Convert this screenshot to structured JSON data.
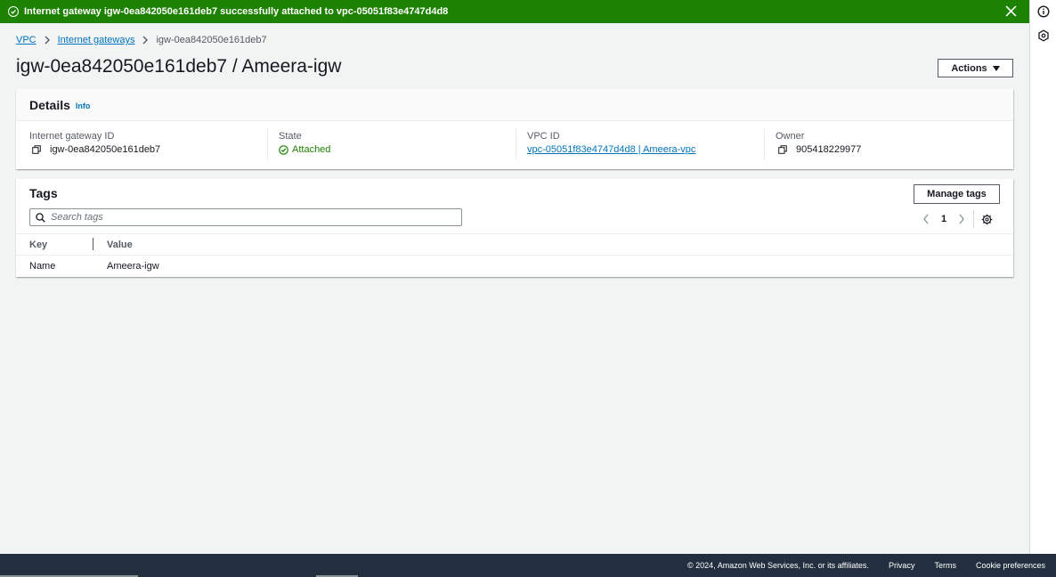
{
  "flash": {
    "message": "Internet gateway igw-0ea842050e161deb7 successfully attached to vpc-05051f83e4747d4d8",
    "color": "#1d8102"
  },
  "breadcrumb": {
    "items": [
      "VPC",
      "Internet gateways"
    ],
    "current": "igw-0ea842050e161deb7"
  },
  "page": {
    "title": "igw-0ea842050e161deb7 / Ameera-igw",
    "actions_label": "Actions"
  },
  "details": {
    "heading": "Details",
    "info": "Info",
    "fields": [
      {
        "label": "Internet gateway ID",
        "value": "igw-0ea842050e161deb7",
        "icon": "copy-icon"
      },
      {
        "label": "State",
        "value": "Attached",
        "icon": "status-check-icon"
      },
      {
        "label": "VPC ID",
        "value": "vpc-05051f83e4747d4d8 | Ameera-vpc",
        "icon": "link"
      },
      {
        "label": "Owner",
        "value": "905418229977",
        "icon": "copy-icon"
      }
    ]
  },
  "tags": {
    "heading": "Tags",
    "manage_label": "Manage tags",
    "search_placeholder": "Search tags",
    "page": "1",
    "columns": [
      "Key",
      "Value"
    ],
    "rows": [
      {
        "key": "Name",
        "value": "Ameera-igw"
      }
    ]
  },
  "footer": {
    "copyright": "© 2024, Amazon Web Services, Inc. or its affiliates.",
    "links": [
      "Privacy",
      "Terms",
      "Cookie preferences"
    ],
    "bg": "#232f3e"
  }
}
